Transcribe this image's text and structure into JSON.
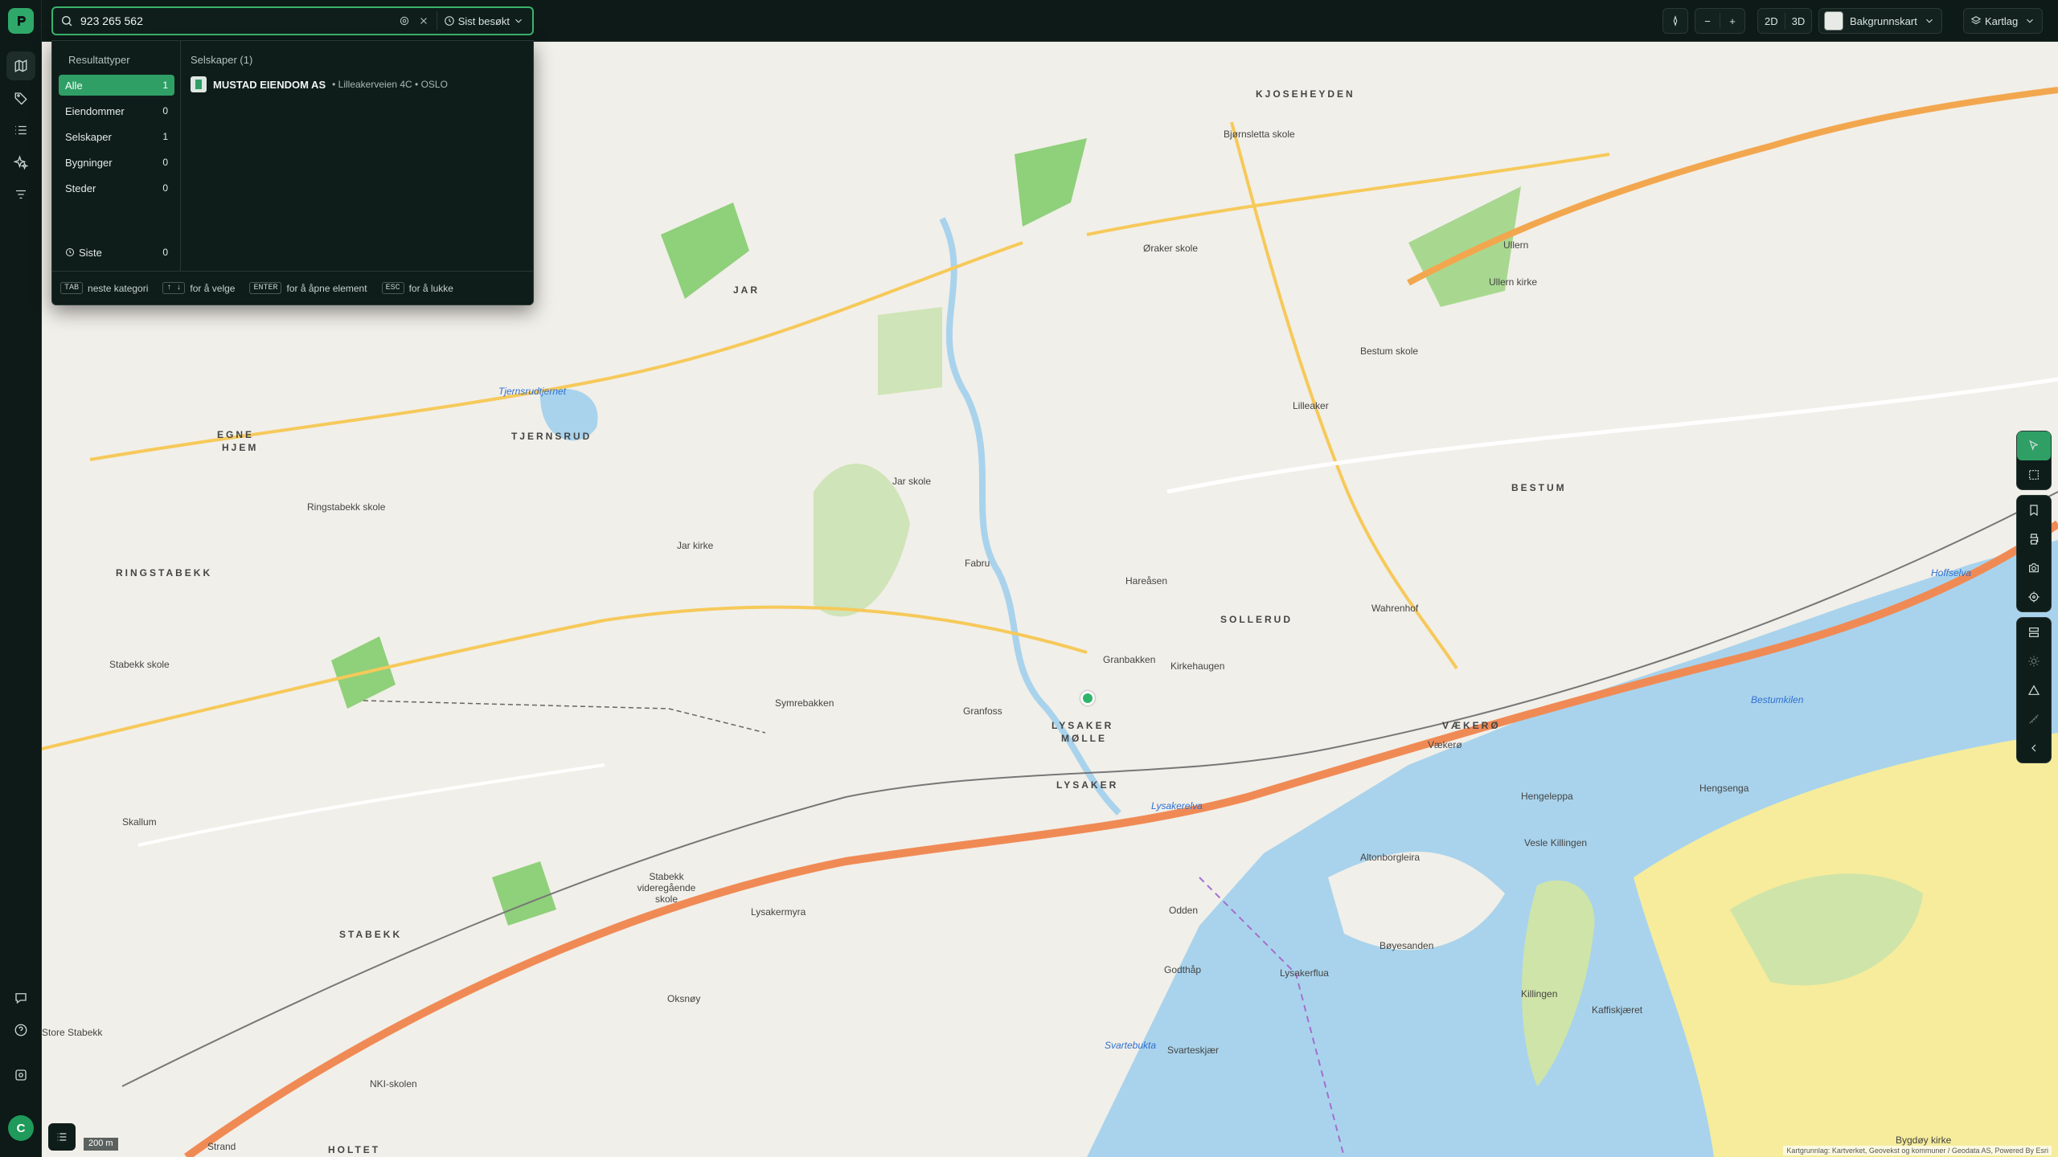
{
  "search": {
    "value": "923 265 562",
    "recent_label": "Sist besøkt"
  },
  "toolbar": {
    "minus": "−",
    "plus": "+",
    "mode_2d": "2D",
    "mode_3d": "3D",
    "basemap_label": "Bakgrunnskart",
    "layers_label": "Kartlag"
  },
  "dropdown": {
    "categories_title": "Resultattyper",
    "categories": [
      {
        "label": "Alle",
        "count": "1"
      },
      {
        "label": "Eiendommer",
        "count": "0"
      },
      {
        "label": "Selskaper",
        "count": "1"
      },
      {
        "label": "Bygninger",
        "count": "0"
      },
      {
        "label": "Steder",
        "count": "0"
      }
    ],
    "recent": {
      "label": "Siste",
      "count": "0"
    },
    "results_title": "Selskaper (1)",
    "result": {
      "name": "MUSTAD EIENDOM AS",
      "meta": "• Lilleakerveien 4C • OSLO"
    },
    "hints": {
      "tab_key": "TAB",
      "tab_text": "neste kategori",
      "arrow_keys": "↑ ↓",
      "arrow_text": "for å velge",
      "enter_key": "ENTER",
      "enter_text": "for å åpne element",
      "esc_key": "ESC",
      "esc_text": "for å lukke"
    }
  },
  "user": {
    "initial": "C"
  },
  "map": {
    "scale": "200 m",
    "attribution": "Kartgrunnlag: Kartverket, Geovekst og kommuner / Geodata AS, Powered By Esri",
    "labels": {
      "jar": "JAR",
      "tjernsrud": "TJERNSRUD",
      "egne_hjem_1": "EGNE",
      "egne_hjem_2": "HJEM",
      "ringstabekk": "RINGSTABEKK",
      "bestum": "BESTUM",
      "sollerud": "SOLLERUD",
      "lysaker_molle_1": "LYSAKER",
      "lysaker_molle_2": "MØLLE",
      "lysaker": "LYSAKER",
      "vaekero": "VÆKERØ",
      "stabekk": "STABEKK",
      "holtet": "HOLTET",
      "kjoseheyden": "KJOSEHEYDEN",
      "lysakerelva": "Lysakerelva",
      "tjernsrudtjernet": "Tjernsrudtjernet",
      "bestumkilen": "Bestumkilen",
      "hoffselva": "Hoffselva",
      "svartebukta": "Svartebukta",
      "jar_skole": "Jar skole",
      "jar_kirke": "Jar kirke",
      "ringstabekk_skole": "Ringstabekk skole",
      "stabekk_skole": "Stabekk skole",
      "bestum_skole": "Bestum skole",
      "ullern_kirke": "Ullern kirke",
      "granfoss": "Granfoss",
      "fabru": "Fabru",
      "granbakken": "Granbakken",
      "hareasen": "Hareåsen",
      "kirkehaugen": "Kirkehaugen",
      "wahrenhof": "Wahrenhof",
      "vaekero_small": "Vækerø",
      "hengsenga": "Hengsenga",
      "hengeleppa": "Hengeleppa",
      "vesle_killingen": "Vesle Killingen",
      "altonborgleira": "Altonborgleira",
      "boyesanden": "Bøyesanden",
      "lysakerflua": "Lysakerflua",
      "killingen": "Killingen",
      "kaffiskjaeret": "Kaffiskjæret",
      "svarteskjaer": "Svarteskjær",
      "odden": "Odden",
      "godthap": "Godthåp",
      "oksnoy": "Oksnøy",
      "store_stabekk": "Store Stabekk",
      "skallum": "Skallum",
      "nki_skolen": "NKI-skolen",
      "strand": "Strand",
      "ulleren": "Ullern",
      "lilleaker": "Lilleaker",
      "symrebakken": "Symrebakken",
      "lysakermyra": "Lysakermyra",
      "bygdoy_kirke": "Bygdøy kirke",
      "stabekk_vgs": "Stabekk videregående skole",
      "orakerskole": "Øraker skole",
      "bjornsletta": "Bjørnsletta skole"
    }
  }
}
